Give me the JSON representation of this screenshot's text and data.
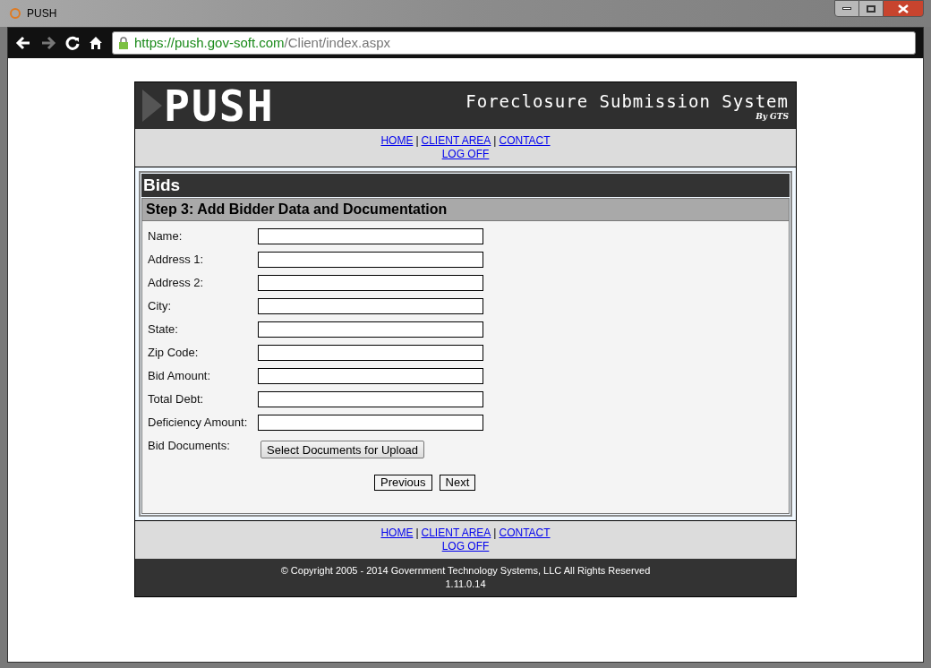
{
  "window": {
    "title": "PUSH"
  },
  "browser": {
    "url_host": "https://push.gov-soft.com",
    "url_path": "/Client/index.aspx"
  },
  "header": {
    "logo": "PUSH",
    "title": "Foreclosure Submission System",
    "byline": "By GTS"
  },
  "nav_top": {
    "separator": "|",
    "links": [
      "HOME",
      "CLIENT AREA",
      "CONTACT"
    ],
    "second_line": "LOG OFF"
  },
  "panel": {
    "title": "Bids",
    "step_title": "Step 3: Add Bidder Data and Documentation",
    "fields": [
      {
        "kind": "text",
        "label": "Name:"
      },
      {
        "kind": "text",
        "label": "Address 1:"
      },
      {
        "kind": "text",
        "label": "Address 2:"
      },
      {
        "kind": "text",
        "label": "City:"
      },
      {
        "kind": "text",
        "label": "State:"
      },
      {
        "kind": "text",
        "label": "Zip Code:"
      },
      {
        "kind": "text",
        "label": "Bid Amount:"
      },
      {
        "kind": "text",
        "label": "Total Debt:"
      },
      {
        "kind": "text",
        "label": "Deficiency Amount:"
      },
      {
        "kind": "upload",
        "label": "Bid Documents:",
        "button": "Select Documents for Upload"
      }
    ],
    "buttons": [
      "Previous",
      "Next"
    ]
  },
  "nav_bottom": {
    "separator": "|",
    "links": [
      "HOME",
      "CLIENT AREA",
      "CONTACT"
    ],
    "second_line": "LOG OFF"
  },
  "footer": {
    "copyright": "© Copyright 2005 - 2014 Government Technology Systems, LLC All Rights Reserved",
    "version": "1.11.0.14"
  }
}
